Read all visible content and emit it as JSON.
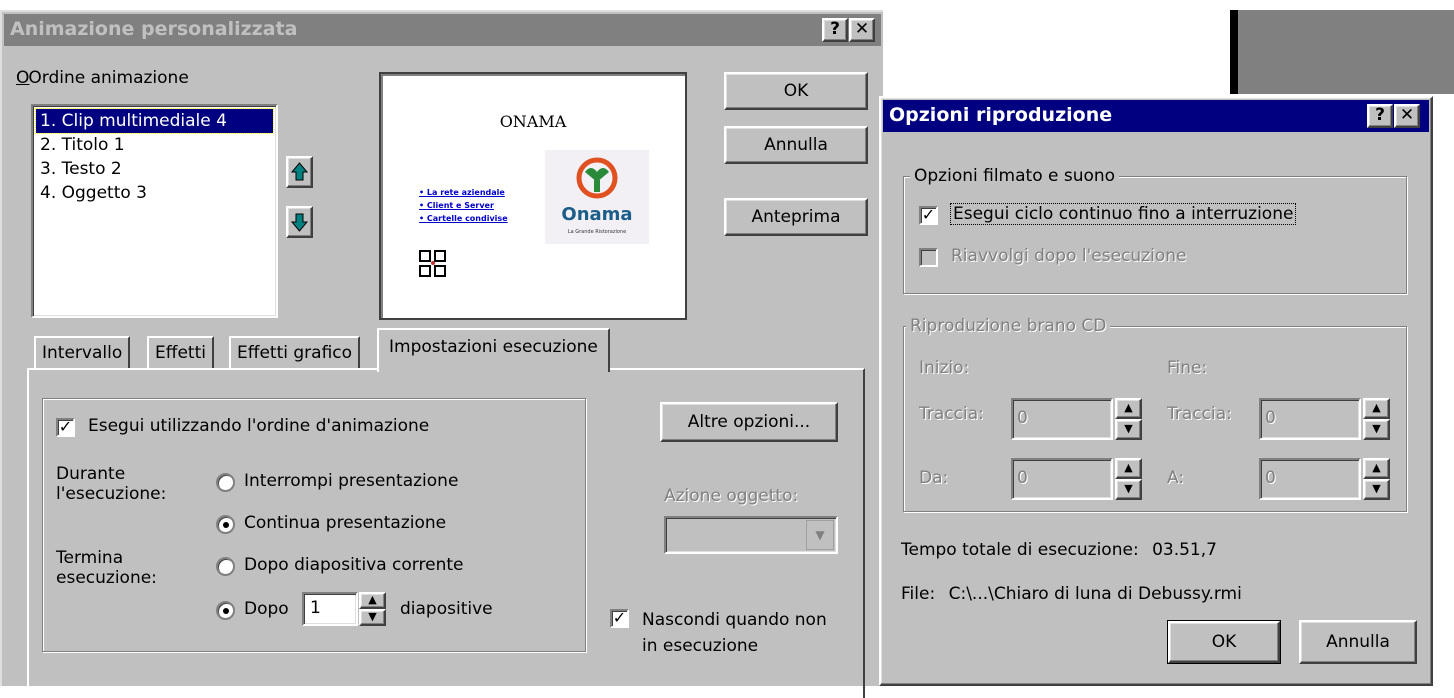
{
  "custom_animation": {
    "title": "Animazione personalizzata",
    "help_btn": "?",
    "close_btn": "✕",
    "order_label": "Ordine animazione",
    "order_items": [
      "1. Clip multimediale 4",
      "2. Titolo 1",
      "3. Testo 2",
      "4. Oggetto 3"
    ],
    "preview": {
      "slide_title": "ONAMA",
      "bullets": [
        "La rete aziendale",
        "Client e Server",
        "Cartelle condivise"
      ],
      "logo_text": "Onama",
      "logo_tagline": "La Grande Ristorazione"
    },
    "ok_label": "OK",
    "cancel_label": "Annulla",
    "preview_label": "Anteprima",
    "tabs": [
      "Intervallo",
      "Effetti",
      "Effetti grafico",
      "Impostazioni esecuzione"
    ],
    "play_using_order_label": "Esegui utilizzando l'ordine d'animazione",
    "during_label_1": "Durante",
    "during_label_2": "l'esecuzione:",
    "radio_pause": "Interrompi presentazione",
    "radio_continue": "Continua presentazione",
    "stop_label_1": "Termina",
    "stop_label_2": "esecuzione:",
    "radio_after_current": "Dopo diapositiva corrente",
    "radio_after": "Dopo",
    "after_value": "1",
    "after_suffix": "diapositive",
    "more_options_label": "Altre opzioni...",
    "object_action_label": "Azione oggetto:",
    "hide_label_1": "Nascondi quando non",
    "hide_label_2": "in esecuzione"
  },
  "play_options": {
    "title": "Opzioni riproduzione",
    "help_btn": "?",
    "close_btn": "✕",
    "movie_group_title": "Opzioni filmato e suono",
    "loop_label": "Esegui ciclo continuo fino a interruzione",
    "rewind_label": "Riavvolgi dopo l'esecuzione",
    "cd_group_title": "Riproduzione brano CD",
    "start_label": "Inizio:",
    "end_label": "Fine:",
    "track_label": "Traccia:",
    "from_label": "Da:",
    "to_label": "A:",
    "start_track": "0",
    "start_from": "0",
    "end_track": "0",
    "end_to": "0",
    "total_time_label": "Tempo totale di esecuzione:",
    "total_time_value": "03.51,7",
    "file_label": "File:",
    "file_value": "C:\\...\\Chiaro di luna di Debussy.rmi",
    "ok_label": "OK",
    "cancel_label": "Annulla"
  },
  "colors": {
    "active_title": "#000080",
    "inactive_title": "#808080",
    "face": "#c0c0c0",
    "selection": "#000080",
    "arrow": "#008080"
  }
}
